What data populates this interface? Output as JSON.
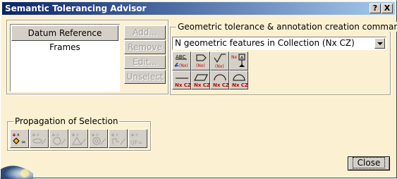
{
  "window": {
    "title": "Semantic Tolerancing Advisor",
    "help_button": "?",
    "close_button": "X"
  },
  "datum_list": {
    "header": "Datum Reference Frames"
  },
  "side_buttons": {
    "add": "Add...",
    "remove": "Remove",
    "edit": "Edit...",
    "unselect": "Unselect"
  },
  "commands_group": {
    "label": "Geometric tolerance & annotation creation commands",
    "selected_option": "N geometric features in Collection (Nx CZ)"
  },
  "propagation_group": {
    "label": "Propagation of Selection"
  },
  "footer": {
    "close_label": "Close"
  },
  "colors": {
    "background": "#fbf1d2",
    "titlebar_start": "#0a246a",
    "titlebar_end": "#a6caf0",
    "icon_red": "#c00000",
    "icon_blue": "#1a3fb0"
  },
  "icons": {
    "command_icons": [
      "text-with-reference-icon",
      "flag-note-icon",
      "roughness-note-icon",
      "datum-target-icon",
      "straightness-icon",
      "flatness-icon",
      "profile-of-line-icon",
      "profile-of-surface-icon"
    ],
    "propagation_icons": [
      "propagate-point-icon",
      "propagate-plane-icon",
      "propagate-circle-icon",
      "propagate-triangle-icon",
      "propagate-circular-pattern-icon",
      "propagate-chain-icon",
      "propagate-uf-icon"
    ]
  }
}
